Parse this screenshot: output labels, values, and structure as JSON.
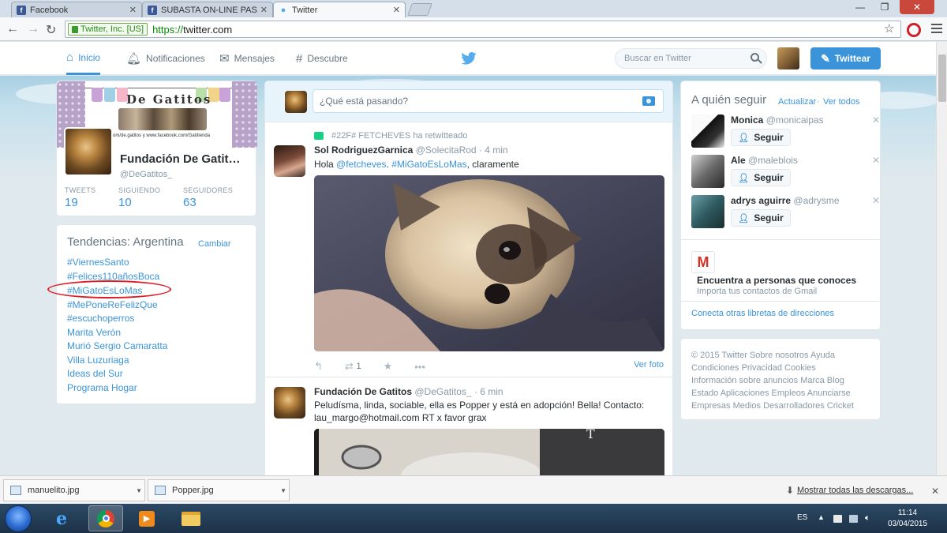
{
  "browser": {
    "tabs": [
      {
        "title": "Facebook",
        "icon": "facebook-icon",
        "color": "#3b5998"
      },
      {
        "title": "SUBASTA ON-LINE PASCUA",
        "icon": "facebook-icon",
        "color": "#3b5998"
      },
      {
        "title": "Twitter",
        "icon": "twitter-bird-icon",
        "color": "#55acee"
      }
    ],
    "ev_badge": "Twitter, Inc. [US]",
    "url_scheme": "https://",
    "url_host": "twitter.com"
  },
  "nav": {
    "home": "Inicio",
    "notifications": "Notificaciones",
    "messages": "Mensajes",
    "discover": "Descubre"
  },
  "search": {
    "placeholder": "Buscar en Twitter"
  },
  "tweet_button": "Twittear",
  "profile": {
    "banner_title": "De Gatitos",
    "banner_url": "facebook.com/de.gatitos y www.facebook.com/Gatitienda",
    "name": "Fundación De Gatit…",
    "handle": "@DeGatitos_",
    "stats": [
      {
        "label": "TWEETS",
        "value": "19"
      },
      {
        "label": "SIGUIENDO",
        "value": "10"
      },
      {
        "label": "SEGUIDORES",
        "value": "63"
      }
    ]
  },
  "trends": {
    "title": "Tendencias: Argentina",
    "change": "Cambiar",
    "items": [
      "#ViernesSanto",
      "#Felices110añosBoca",
      "#MiGatoEsLoMas",
      "#MePoneReFelizQue",
      "#escuchoperros",
      "Marita Verón",
      "Murió Sergio Camaratta",
      "Villa Luzuriaga",
      "Ideas del Sur",
      "Programa Hogar"
    ]
  },
  "compose": {
    "placeholder": "¿Qué está pasando?"
  },
  "tweets": [
    {
      "retweeted_by": "#22F# FETCHEVES ha retwitteado",
      "name": "Sol RodriguezGarnica",
      "handle": "@SolecitaRod · 4 min",
      "text_prefix": "Hola ",
      "mention": "@fetcheves",
      "text_mid": ". ",
      "hashtag": "#MiGatoEsLoMas",
      "text_suffix": ", claramente",
      "retweets": "1",
      "view_photo": "Ver foto"
    },
    {
      "name": "Fundación De Gatitos",
      "handle": "@DeGatitos_ · 6 min",
      "text": "Peludísma, linda, sociable, ella es Popper y está en adopción! Bella! Contacto: lau_margo@hotmail.com RT x favor grax"
    }
  ],
  "who_to_follow": {
    "title": "A quién seguir",
    "refresh": "Actualizar",
    "view_all": "Ver todos",
    "follow_label": "Seguir",
    "users": [
      {
        "name": "Monica",
        "handle": "@monicaipas"
      },
      {
        "name": "Ale",
        "handle": "@maleblois"
      },
      {
        "name": "adrys aguirre",
        "handle": "@adrysme"
      }
    ],
    "gmail_title": "Encuentra a personas que conoces",
    "gmail_sub": "Importa tus contactos de Gmail",
    "connect": "Conecta otras libretas de direcciones"
  },
  "footer": {
    "lines": [
      "© 2015 Twitter  Sobre nosotros  Ayuda",
      "Condiciones  Privacidad  Cookies",
      "Información sobre anuncios  Marca  Blog",
      "Estado  Aplicaciones  Empleos  Anunciarse",
      "Empresas  Medios  Desarrolladores  Cricket"
    ]
  },
  "downloads": {
    "items": [
      "manuelito.jpg",
      "Popper.jpg"
    ],
    "show_all": "Mostrar todas las descargas..."
  },
  "taskbar": {
    "lang": "ES",
    "time": "11:14",
    "date": "03/04/2015"
  },
  "colors": {
    "accent": "#3b94d9",
    "retweet": "#19cf86",
    "highlight": "#e01b24"
  }
}
